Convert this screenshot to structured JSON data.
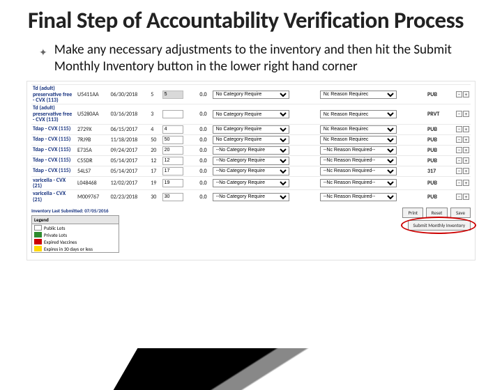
{
  "title": "Final Step of Accountability Verification Process",
  "bullet": "Make any necessary adjustments to the inventory and then hit the Submit Monthly Inventory button in the lower right hand corner",
  "dropdown": {
    "cat": "No Category Require",
    "catlong": "--No Category Require",
    "reason": "Nc Reason Requirec",
    "reasonlong": "--Nc Reason Required--"
  },
  "rows": [
    {
      "name": "Td (adult) preservative free - CVX (113)",
      "lot": "U5411AA",
      "date": "06/30/2018",
      "n1": "5",
      "inp": "5",
      "n0": "0.0",
      "fund": "PUB",
      "grey": true,
      "catlong": false
    },
    {
      "name": "Td (adult) preservative free - CVX (113)",
      "lot": "U5280AA",
      "date": "03/16/2018",
      "n1": "3",
      "inp": "",
      "n0": "0.0",
      "fund": "PRVT",
      "grey": false,
      "catlong": false
    },
    {
      "name": "Tdap - CVX (115)",
      "lot": "2729X",
      "date": "06/15/2017",
      "n1": "4",
      "inp": "4",
      "n0": "0.0",
      "fund": "PUB",
      "grey": false,
      "catlong": false
    },
    {
      "name": "Tdap - CVX (115)",
      "lot": "7RJ9B",
      "date": "11/18/2018",
      "n1": "50",
      "inp": "50",
      "n0": "0.0",
      "fund": "PUB",
      "grey": false,
      "catlong": false
    },
    {
      "name": "Tdap - CVX (115)",
      "lot": "E735A",
      "date": "09/24/2017",
      "n1": "20",
      "inp": "20",
      "n0": "0.0",
      "fund": "PUB",
      "grey": false,
      "catlong": true
    },
    {
      "name": "Tdap - CVX (115)",
      "lot": "C55DR",
      "date": "05/14/2017",
      "n1": "12",
      "inp": "12",
      "n0": "0.0",
      "fund": "PUB",
      "grey": false,
      "catlong": true
    },
    {
      "name": "Tdap - CVX (115)",
      "lot": "54LS7",
      "date": "05/14/2017",
      "n1": "17",
      "inp": "17",
      "n0": "0.0",
      "fund": "317",
      "grey": false,
      "catlong": true
    },
    {
      "name": "varicella - CVX (21)",
      "lot": "L048468",
      "date": "12/02/2017",
      "n1": "19",
      "inp": "19",
      "n0": "0.0",
      "fund": "PUB",
      "grey": false,
      "catlong": true
    },
    {
      "name": "varicella - CVX (21)",
      "lot": "M009767",
      "date": "02/23/2018",
      "n1": "30",
      "inp": "30",
      "n0": "0.0",
      "fund": "PUB",
      "grey": false,
      "catlong": true
    }
  ],
  "lastSubmitted": "Inventory Last Submitted: 07/05/2016",
  "legend": {
    "title": "Legend",
    "items": [
      "Public Lots",
      "Private Lots",
      "Expired Vaccines",
      "Expires in 30 days or less"
    ]
  },
  "buttons": {
    "print": "Print",
    "reset": "Reset",
    "save": "Save",
    "submit": "Submit Monthly Inventory"
  },
  "icons": {
    "minus": "–",
    "plus": "+"
  }
}
